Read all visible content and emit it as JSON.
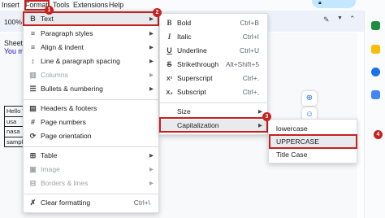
{
  "menubar": {
    "items": [
      {
        "label": "Insert"
      },
      {
        "label": "Format"
      },
      {
        "label": "Tools"
      },
      {
        "label": "Extensions"
      },
      {
        "label": "Help"
      }
    ]
  },
  "toolbar": {
    "zoom": "100%"
  },
  "document": {
    "line1": "Sheets",
    "line2": "You ma",
    "table": [
      [
        "Hello V"
      ],
      [
        "usa"
      ],
      [
        "nasa"
      ],
      [
        "sample"
      ]
    ]
  },
  "format_menu": {
    "items": [
      {
        "icon": "bold-b-icon",
        "glyph": "B",
        "label": "Text",
        "submenu": true,
        "disabled": false
      },
      {
        "icon": "paragraph-styles-icon",
        "glyph": "≡",
        "label": "Paragraph styles",
        "submenu": true,
        "disabled": false
      },
      {
        "icon": "align-indent-icon",
        "glyph": "≡",
        "label": "Align & indent",
        "submenu": true,
        "disabled": false
      },
      {
        "icon": "line-spacing-icon",
        "glyph": "↕",
        "label": "Line & paragraph spacing",
        "submenu": true,
        "disabled": false
      },
      {
        "icon": "columns-icon",
        "glyph": "▥",
        "label": "Columns",
        "submenu": true,
        "disabled": true
      },
      {
        "icon": "bullets-icon",
        "glyph": "☰",
        "label": "Bullets & numbering",
        "submenu": true,
        "disabled": false
      },
      {
        "icon": "headers-footers-icon",
        "glyph": "▤",
        "label": "Headers & footers",
        "submenu": false,
        "disabled": false
      },
      {
        "icon": "page-numbers-icon",
        "glyph": "#",
        "label": "Page numbers",
        "submenu": false,
        "disabled": false
      },
      {
        "icon": "page-orientation-icon",
        "glyph": "⟳",
        "label": "Page orientation",
        "submenu": false,
        "disabled": false
      },
      {
        "icon": "table-icon",
        "glyph": "⊞",
        "label": "Table",
        "submenu": true,
        "disabled": false
      },
      {
        "icon": "image-icon",
        "glyph": "▣",
        "label": "Image",
        "submenu": true,
        "disabled": true
      },
      {
        "icon": "borders-lines-icon",
        "glyph": "⊟",
        "label": "Borders & lines",
        "submenu": true,
        "disabled": true
      },
      {
        "icon": "clear-formatting-icon",
        "glyph": "✗",
        "label": "Clear formatting",
        "shortcut": "Ctrl+\\",
        "submenu": false,
        "disabled": false
      }
    ]
  },
  "text_menu": {
    "items": [
      {
        "icon": "bold-icon",
        "glyph": "B",
        "label": "Bold",
        "shortcut": "Ctrl+B"
      },
      {
        "icon": "italic-icon",
        "glyph": "I",
        "label": "Italic",
        "shortcut": "Ctrl+I"
      },
      {
        "icon": "underline-icon",
        "glyph": "U",
        "label": "Underline",
        "shortcut": "Ctrl+U"
      },
      {
        "icon": "strikethrough-icon",
        "glyph": "S",
        "label": "Strikethrough",
        "shortcut": "Alt+Shift+5"
      },
      {
        "icon": "superscript-icon",
        "glyph": "X²",
        "label": "Superscript",
        "shortcut": "Ctrl+."
      },
      {
        "icon": "subscript-icon",
        "glyph": "X₂",
        "label": "Subscript",
        "shortcut": "Ctrl+,"
      },
      {
        "label": "Size",
        "submenu": true
      },
      {
        "label": "Capitalization",
        "submenu": true
      }
    ]
  },
  "cap_menu": {
    "items": [
      {
        "label": "lowercase"
      },
      {
        "label": "UPPERCASE"
      },
      {
        "label": "Title Case"
      }
    ]
  },
  "steps": [
    "1",
    "2",
    "3",
    "4"
  ],
  "colors": {
    "highlight": "#c5221f",
    "selected_bg": "#e8eaed",
    "toolbar_bg": "#edf2fa"
  }
}
